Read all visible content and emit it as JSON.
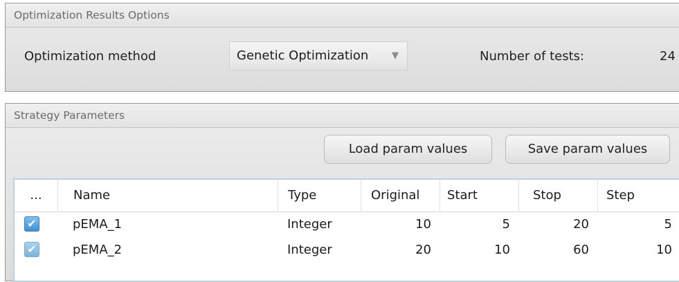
{
  "optimization_group": {
    "title": "Optimization Results Options",
    "method_label": "Optimization method",
    "method_value": "Genetic Optimization",
    "tests_label": "Number of tests:",
    "tests_value": "24"
  },
  "strategy_group": {
    "title": "Strategy Parameters",
    "load_button": "Load param values",
    "save_button": "Save param values",
    "table": {
      "headers": [
        "...",
        "Name",
        "Type",
        "Original",
        "Start",
        "Stop",
        "Step"
      ],
      "rows": [
        {
          "checked": true,
          "name": "pEMA_1",
          "type": "Integer",
          "original": "10",
          "start": "5",
          "stop": "20",
          "step": "5"
        },
        {
          "checked": true,
          "name": "pEMA_2",
          "type": "Integer",
          "original": "20",
          "start": "10",
          "stop": "60",
          "step": "10"
        }
      ]
    }
  },
  "icons": {
    "dropdown": "chevron-down-icon",
    "check": "checkmark-icon"
  }
}
